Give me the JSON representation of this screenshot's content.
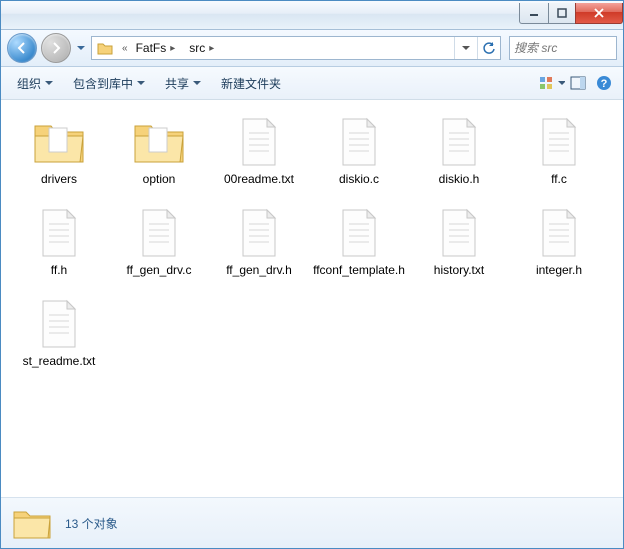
{
  "window": {
    "title": ""
  },
  "nav": {
    "crumbs": [
      "FatFs",
      "src"
    ],
    "crumb_prefix": "«"
  },
  "search": {
    "placeholder": "搜索 src"
  },
  "toolbar": {
    "organize": "组织",
    "include": "包含到库中",
    "share": "共享",
    "newfolder": "新建文件夹"
  },
  "items": [
    {
      "name": "drivers",
      "type": "folder"
    },
    {
      "name": "option",
      "type": "folder"
    },
    {
      "name": "00readme.txt",
      "type": "file"
    },
    {
      "name": "diskio.c",
      "type": "file"
    },
    {
      "name": "diskio.h",
      "type": "file"
    },
    {
      "name": "ff.c",
      "type": "file"
    },
    {
      "name": "ff.h",
      "type": "file"
    },
    {
      "name": "ff_gen_drv.c",
      "type": "file"
    },
    {
      "name": "ff_gen_drv.h",
      "type": "file"
    },
    {
      "name": "ffconf_template.h",
      "type": "file"
    },
    {
      "name": "history.txt",
      "type": "file"
    },
    {
      "name": "integer.h",
      "type": "file"
    },
    {
      "name": "st_readme.txt",
      "type": "file"
    }
  ],
  "status": {
    "count_text": "13 个对象"
  },
  "colors": {
    "accent": "#2a6fb0",
    "close": "#cf3a28",
    "folder": "#f6d27a"
  }
}
